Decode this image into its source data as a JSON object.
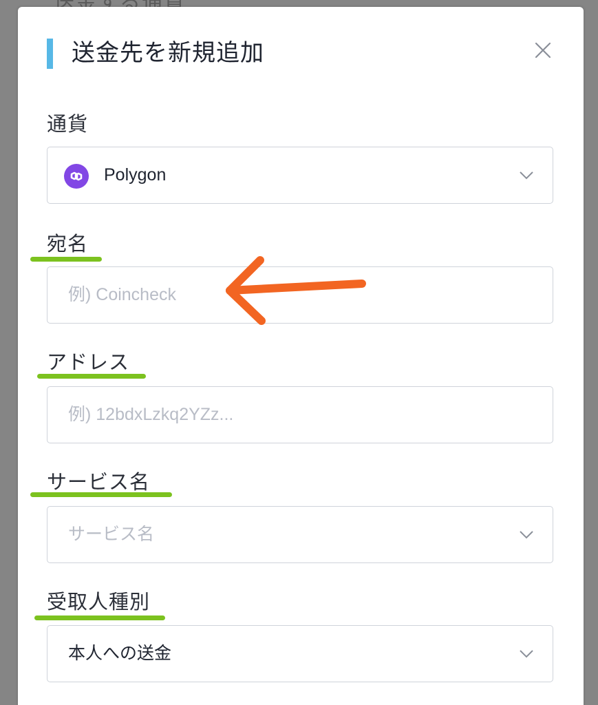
{
  "modal": {
    "title": "送金先を新規追加",
    "close_icon": "close-icon"
  },
  "fields": {
    "currency": {
      "label": "通貨",
      "value": "Polygon",
      "icon": "polygon-coin-icon",
      "icon_color": "#8247e5"
    },
    "name": {
      "label": "宛名",
      "placeholder": "例) Coincheck"
    },
    "address": {
      "label": "アドレス",
      "placeholder": "例) 12bdxLzkq2YZz..."
    },
    "service": {
      "label": "サービス名",
      "placeholder": "サービス名"
    },
    "recipient_type": {
      "label": "受取人種別",
      "value": "本人への送金"
    }
  },
  "annotations": {
    "underline_color": "#7cc21f",
    "arrow_color": "#f26522",
    "arrow_icon": "left-arrow-icon"
  },
  "accent_color": "#57b8e6"
}
